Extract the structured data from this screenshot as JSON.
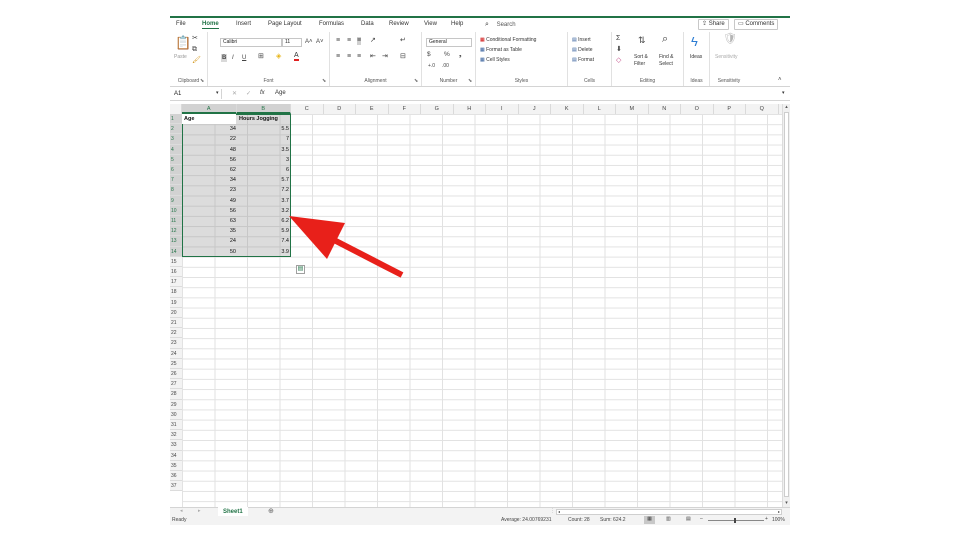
{
  "menu": {
    "tabs": [
      "File",
      "Home",
      "Insert",
      "Page Layout",
      "Formulas",
      "Data",
      "Review",
      "View",
      "Help"
    ],
    "active_tab": "Home",
    "search_placeholder": "Search",
    "share_label": "Share",
    "comments_label": "Comments"
  },
  "ribbon": {
    "clipboard": {
      "label": "Clipboard",
      "paste": "Paste"
    },
    "font": {
      "label": "Font",
      "font_name": "Calibri",
      "font_size": "11",
      "bold": "B",
      "italic": "I",
      "underline": "U"
    },
    "alignment": {
      "label": "Alignment"
    },
    "number": {
      "label": "Number",
      "format": "General",
      "currency": "$",
      "percent": "%"
    },
    "styles": {
      "label": "Styles",
      "conditional": "Conditional Formatting",
      "format_table": "Format as Table",
      "cell_styles": "Cell Styles"
    },
    "cells": {
      "label": "Cells",
      "insert": "Insert",
      "delete": "Delete",
      "format": "Format"
    },
    "editing": {
      "label": "Editing",
      "sort_filter_1": "Sort &",
      "sort_filter_2": "Filter",
      "find_select_1": "Find &",
      "find_select_2": "Select"
    },
    "ideas": {
      "label": "Ideas",
      "button": "Ideas"
    },
    "sensitivity": {
      "label": "Sensitivity",
      "button": "Sensitivity"
    }
  },
  "formula_bar": {
    "name_box": "A1",
    "fx": "fx",
    "content": "Age"
  },
  "columns": [
    "A",
    "B",
    "C",
    "D",
    "E",
    "F",
    "G",
    "H",
    "I",
    "J",
    "K",
    "L",
    "M",
    "N",
    "O",
    "P",
    "Q"
  ],
  "headers": {
    "a": "Age",
    "b": "Hours Jogging"
  },
  "rows": [
    {
      "age": "34",
      "hours": "5.5"
    },
    {
      "age": "22",
      "hours": "7"
    },
    {
      "age": "48",
      "hours": "3.5"
    },
    {
      "age": "56",
      "hours": "3"
    },
    {
      "age": "62",
      "hours": "6"
    },
    {
      "age": "34",
      "hours": "5.7"
    },
    {
      "age": "23",
      "hours": "7.2"
    },
    {
      "age": "49",
      "hours": "3.7"
    },
    {
      "age": "56",
      "hours": "3.2"
    },
    {
      "age": "63",
      "hours": "6.2"
    },
    {
      "age": "35",
      "hours": "5.9"
    },
    {
      "age": "24",
      "hours": "7.4"
    },
    {
      "age": "50",
      "hours": "3.9"
    }
  ],
  "row_count": 37,
  "sheet": {
    "tab_name": "Sheet1"
  },
  "status": {
    "ready": "Ready",
    "average": "Average: 24.00769231",
    "count": "Count: 28",
    "sum": "Sum: 624.2",
    "zoom": "100%"
  },
  "colors": {
    "accent": "#217346",
    "annotation_arrow": "#e8201a"
  }
}
